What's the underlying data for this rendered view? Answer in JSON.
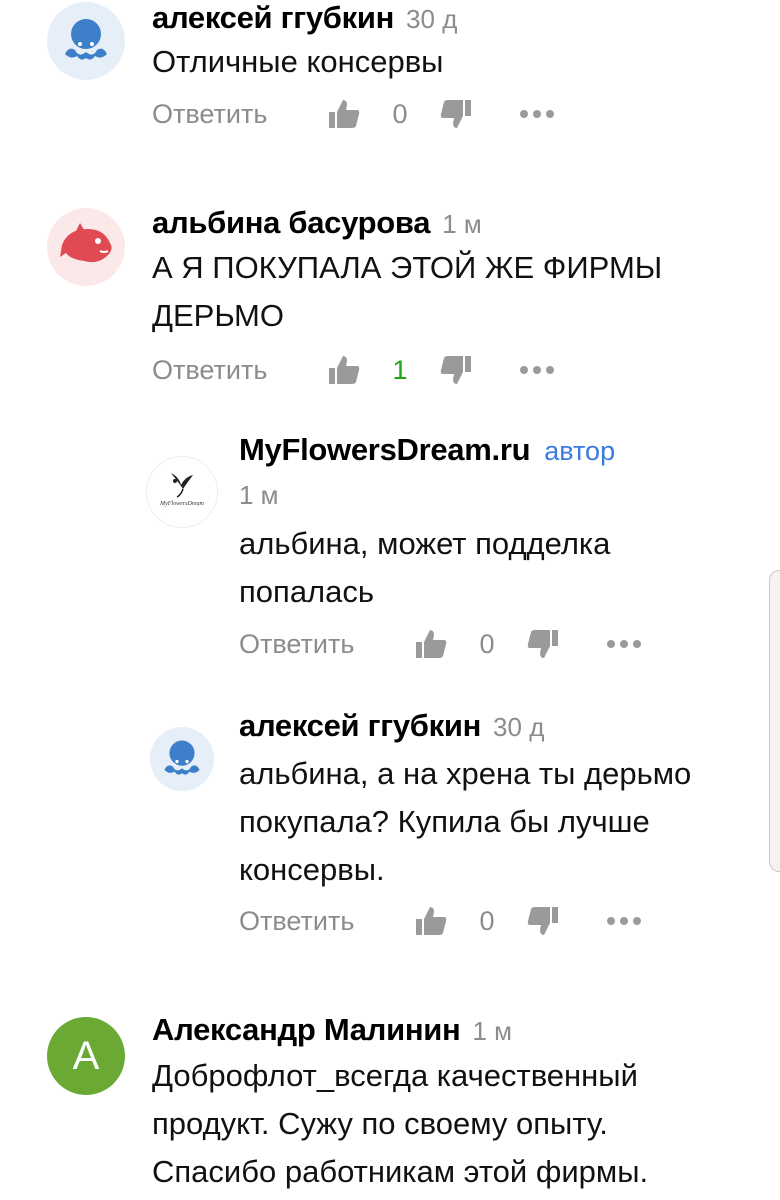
{
  "colors": {
    "time": "#8c8c8c",
    "author_badge": "#3a7be0",
    "positive_count": "#1aa81a",
    "avatar_octopus_bg": "#e6eef8",
    "avatar_octopus_fg": "#3d7fc9",
    "avatar_fish_bg": "#fbe9ea",
    "avatar_fish_fg": "#e04b53",
    "avatar_letter_bg": "#6aaa34"
  },
  "comments": [
    {
      "author": "алексей ггубкин",
      "time": "30 д",
      "text": "Отличные консервы",
      "reply_label": "Ответить",
      "likes": "0",
      "avatar_icon": "octopus-icon"
    },
    {
      "author": "альбина басурова",
      "time": "1 м",
      "text_line1": "А Я ПОКУПАЛА ЭТОЙ ЖЕ ФИРМЫ",
      "text_line2": "ДЕРЬМО",
      "reply_label": "Ответить",
      "likes": "1",
      "avatar_icon": "fish-icon"
    },
    {
      "author": "MyFlowersDream.ru",
      "badge": "автор",
      "time": "1 м",
      "text_line1": "альбина, может подделка",
      "text_line2": "попалась",
      "reply_label": "Ответить",
      "likes": "0",
      "avatar_icon": "flowers-logo-icon",
      "avatar_caption": "MyFlowersDream"
    },
    {
      "author": "алексей ггубкин",
      "time": "30 д",
      "text_line1": "альбина, а на хрена ты дерьмо",
      "text_line2": "покупала? Купила бы лучше",
      "text_line3": "консервы.",
      "reply_label": "Ответить",
      "likes": "0",
      "avatar_icon": "octopus-icon"
    },
    {
      "author": "Александр Малинин",
      "time": "1 м",
      "text_line1": "Доброфлот_всегда качественный",
      "text_line2": "продукт. Сужу по своему опыту.",
      "text_line3": "Спасибо работникам этой фирмы.",
      "avatar_letter": "А"
    }
  ]
}
